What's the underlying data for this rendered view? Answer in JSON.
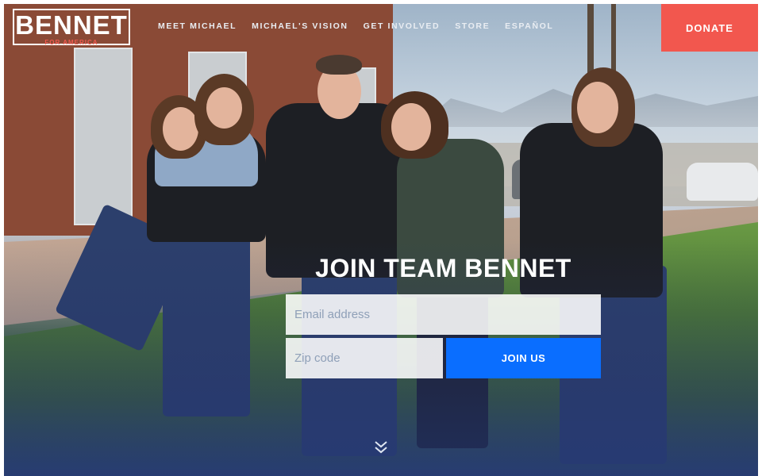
{
  "logo": {
    "word": "BENNET",
    "sub": "FOR AMERICA"
  },
  "nav": {
    "items": [
      {
        "label": "MEET MICHAEL"
      },
      {
        "label": "MICHAEL'S VISION"
      },
      {
        "label": "GET INVOLVED"
      },
      {
        "label": "STORE"
      },
      {
        "label": "ESPAÑOL"
      }
    ],
    "donate_label": "DONATE"
  },
  "hero": {
    "headline": "JOIN TEAM BENNET",
    "email_placeholder": "Email address",
    "zip_placeholder": "Zip code",
    "submit_label": "JOIN US",
    "scroll_icon": "chevron-double-down-icon"
  },
  "colors": {
    "accent": "#f2574e",
    "button": "#0a6eff",
    "logo_sub": "#ef5a4f"
  }
}
